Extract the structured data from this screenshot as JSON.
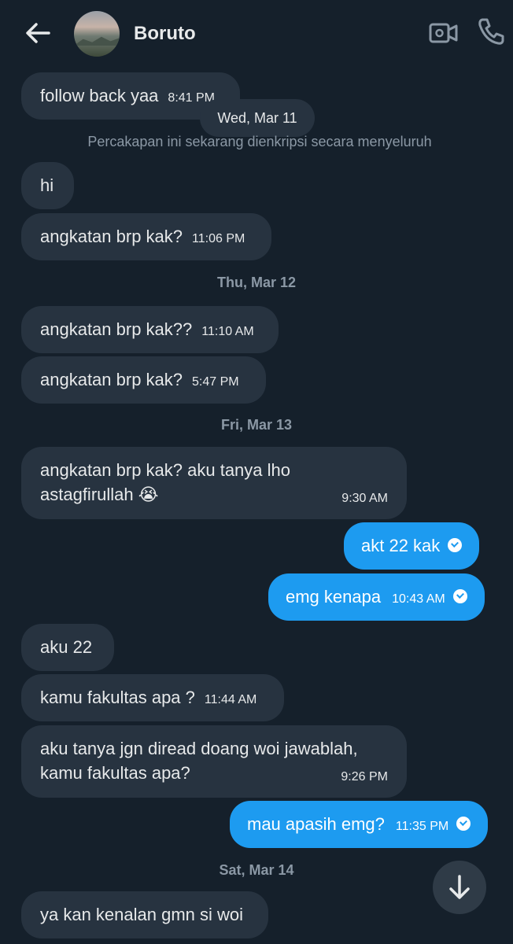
{
  "header": {
    "contact_name": "Boruto",
    "back_icon": "arrow-left-icon",
    "video_icon": "video-call-icon",
    "phone_icon": "phone-icon"
  },
  "messages": [
    {
      "text": "follow back yaa",
      "time": "8:41 PM"
    },
    {
      "text": "hi"
    },
    {
      "text": "angkatan brp kak?",
      "time": "11:06 PM"
    },
    {
      "text": "angkatan brp kak??",
      "time": "11:10 AM"
    },
    {
      "text": "angkatan brp kak?",
      "time": "5:47 PM"
    },
    {
      "text_line1": "angkatan brp kak? aku tanya lho",
      "text_line2": "astagfirullah 😭",
      "time": "9:30 AM"
    },
    {
      "text": "aku 22"
    },
    {
      "text": "kamu fakultas apa ?",
      "time": "11:44 AM"
    },
    {
      "text_line1": "aku tanya jgn diread doang woi jawablah,",
      "text_line2": "kamu fakultas apa?",
      "time": "9:26 PM"
    },
    {
      "text": "ya kan kenalan gmn si woi"
    }
  ],
  "sent": [
    {
      "text": "akt 22 kak"
    },
    {
      "text": "emg kenapa",
      "time": "10:43 AM"
    },
    {
      "text": "mau apasih emg?",
      "time": "11:35 PM"
    }
  ],
  "dates": {
    "wed": "Wed, Mar 11",
    "thu": "Thu, Mar 12",
    "fri": "Fri, Mar 13",
    "sat": "Sat, Mar 14"
  },
  "encryption_notice": "Percakapan ini sekarang dienkripsi secara menyeluruh",
  "colors": {
    "background": "#15202b",
    "received_bubble": "#273340",
    "sent_bubble": "#1d9bf0",
    "muted_text": "#8b98a5"
  },
  "scroll_button_icon": "arrow-down-icon"
}
